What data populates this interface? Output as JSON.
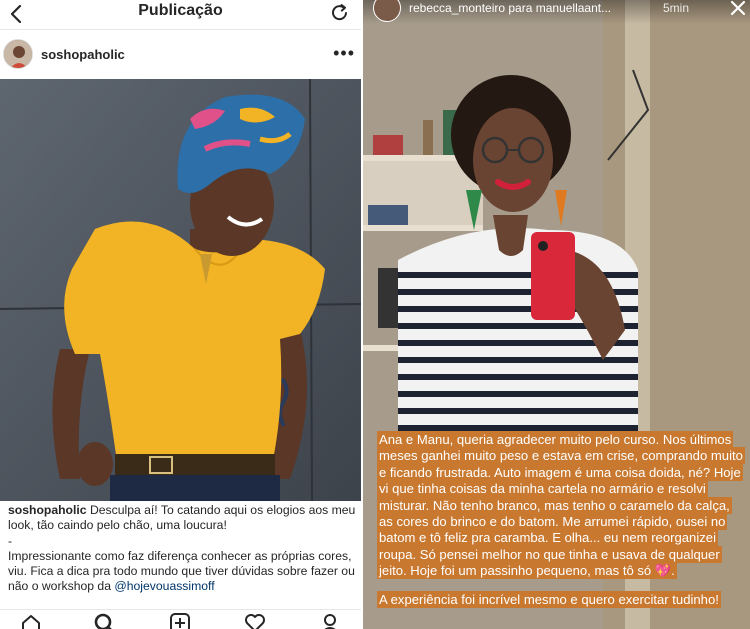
{
  "post": {
    "topbar": {
      "title": "Publicação",
      "back_icon": "chevron-left-icon",
      "refresh_icon": "refresh-icon"
    },
    "header": {
      "username": "soshopaholic",
      "more_label": "•••"
    },
    "caption": {
      "username": "soshopaholic",
      "text1": " Desculpa aí! To catando aqui os elogios aos meu look, tão caindo pelo chão, uma loucura!",
      "separator": "-",
      "text2": "Impressionante como faz diferença conhecer as próprias cores, viu. Fica a dica pra todo mundo que tiver dúvidas sobre fazer ou não o workshop da ",
      "mention": "@hojevouassimoff"
    },
    "nav": [
      "home-icon",
      "search-icon",
      "add-icon",
      "heart-icon",
      "profile-icon"
    ]
  },
  "story": {
    "username": "rebecca_monteiro para manuellaant...",
    "time": "5min",
    "close_icon": "close-icon",
    "paragraph1": "Ana e Manu, queria agradecer muito pelo curso. Nos últimos meses ganhei muito peso e estava em crise, comprando muito e ficando frustrada. Auto imagem é uma coisa doida, né? Hoje vi que tinha coisas da minha cartela no armário e resolvi misturar. Não tenho branco, mas tenho o caramelo da calça, as cores do brinco e do batom. Me arrumei rápido, ousei no batom e tô feliz pra caramba. E olha... eu nem reorganizei roupa. Só pensei melhor no que tinha e usava de qualquer jeito. Hoje foi um passinho pequeno, mas tô só 💖.",
    "paragraph2": "A experiência foi incrível mesmo e quero exercitar tudinho!",
    "highlight_color": "#c9782f"
  }
}
